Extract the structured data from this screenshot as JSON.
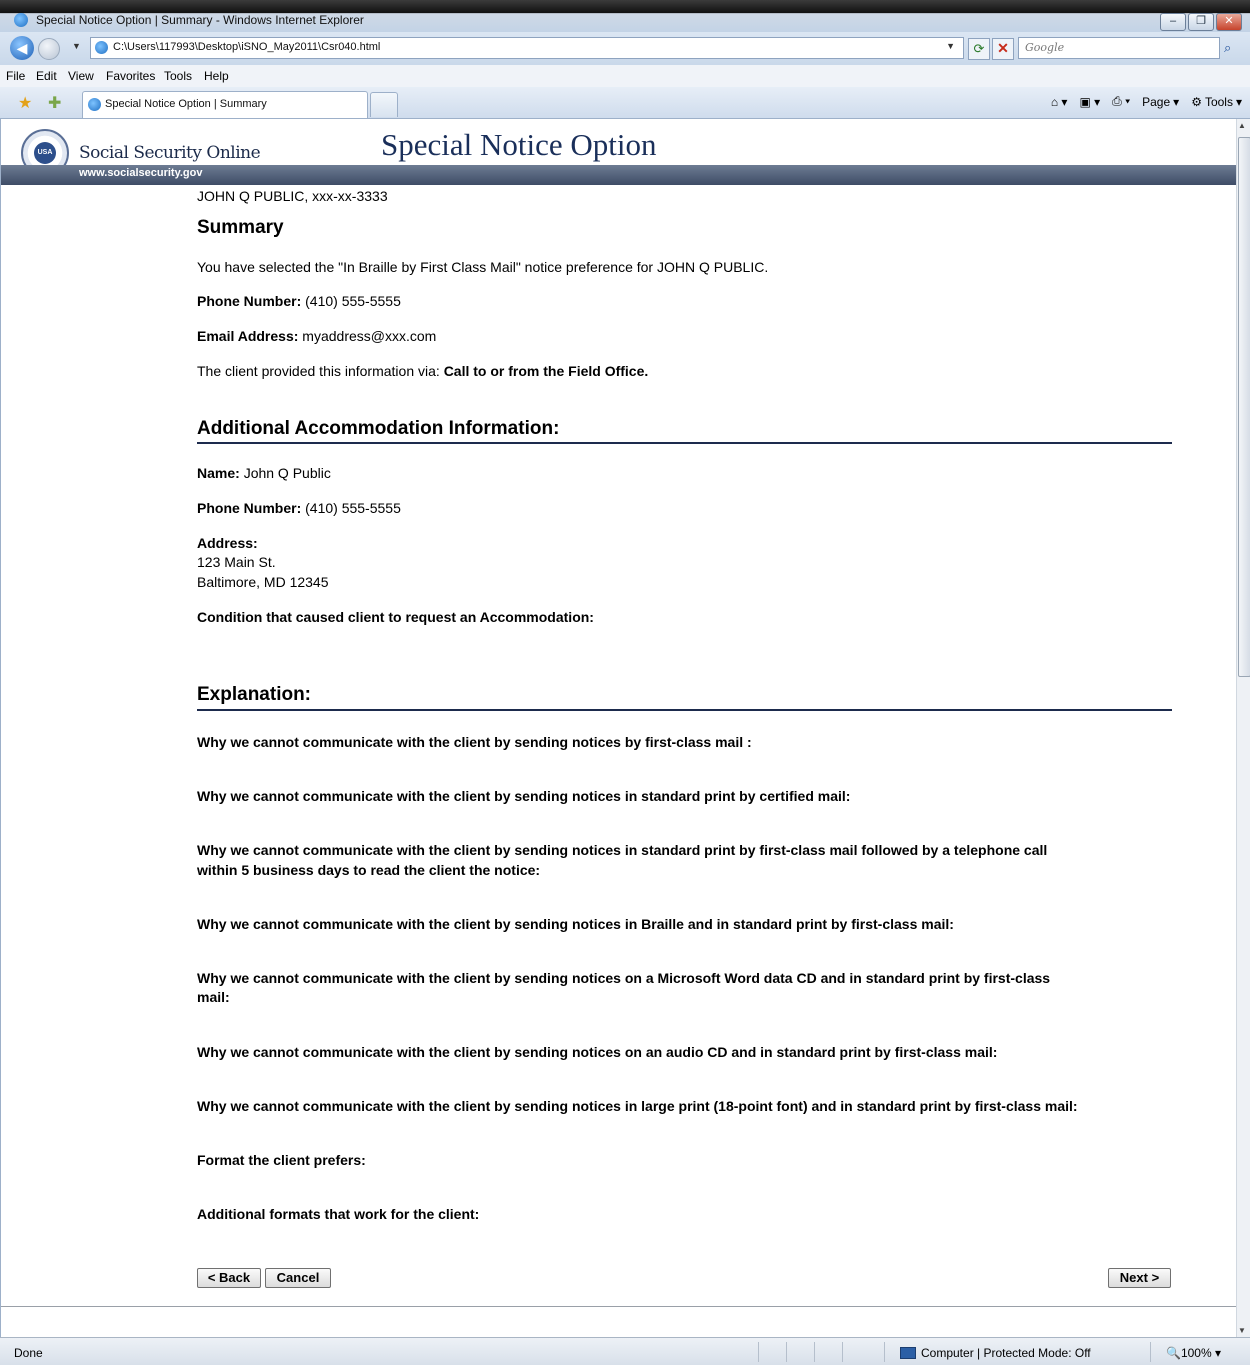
{
  "window": {
    "title": "Special Notice Option | Summary - Windows Internet Explorer",
    "address": "C:\\Users\\117993\\Desktop\\iSNO_May2011\\Csr040.html",
    "search_placeholder": "Google",
    "menu": [
      "File",
      "Edit",
      "View",
      "Favorites",
      "Tools",
      "Help"
    ],
    "tab_label": "Special Notice Option | Summary",
    "cmd_page": "Page",
    "cmd_tools": "Tools",
    "status_done": "Done",
    "status_zone": "Computer | Protected Mode: Off",
    "status_zoom": "100%"
  },
  "header": {
    "brand": "Social Security Online",
    "title": "Special Notice Option",
    "url": "www.socialsecurity.gov",
    "seal_text": "USA"
  },
  "client_line": "JOHN Q PUBLIC, xxx-xx-3333",
  "summary": {
    "heading": "Summary",
    "selection_text": "You have selected the \"In Braille by First Class Mail\" notice preference for JOHN Q PUBLIC.",
    "phone_label": "Phone Number:",
    "phone_value": "(410) 555-5555",
    "email_label": "Email Address:",
    "email_value": "myaddress@xxx.com",
    "via_label": "The client provided this information via:",
    "via_value": "Call to or from the Field Office."
  },
  "accommodation": {
    "heading": "Additional Accommodation Information:",
    "name_label": "Name:",
    "name_value": "John Q Public",
    "phone_label": "Phone Number:",
    "phone_value": "(410) 555-5555",
    "address_label": "Address:",
    "address_line1": "123 Main St.",
    "address_line2": "Baltimore, MD 12345",
    "condition_label": "Condition that caused client to request an Accommodation:"
  },
  "explanation": {
    "heading": "Explanation:",
    "q1": "Why we cannot communicate with the client by sending notices by first-class mail :",
    "q2": "Why we cannot communicate with the client by sending notices in standard print by certified mail:",
    "q3a": "Why we cannot communicate with the client by sending notices in standard print by first-class mail followed by a telephone call",
    "q3b": "within 5 business days to read the client the notice:",
    "q4": "Why we cannot communicate with the client by sending notices in Braille and in standard print by first-class mail:",
    "q5a": "Why we cannot communicate with the client by sending notices on a Microsoft Word data CD and in standard print by first-class",
    "q5b": "mail:",
    "q6": "Why we cannot communicate with the client by sending notices on an audio CD and in standard print by first-class mail:",
    "q7": "Why we cannot communicate with the client by sending notices in large print (18-point font) and in standard print by first-class mail:",
    "format_pref": "Format the client prefers:",
    "additional_formats": "Additional formats that work for the client:"
  },
  "buttons": {
    "back": "< Back",
    "cancel": "Cancel",
    "next": "Next >"
  }
}
